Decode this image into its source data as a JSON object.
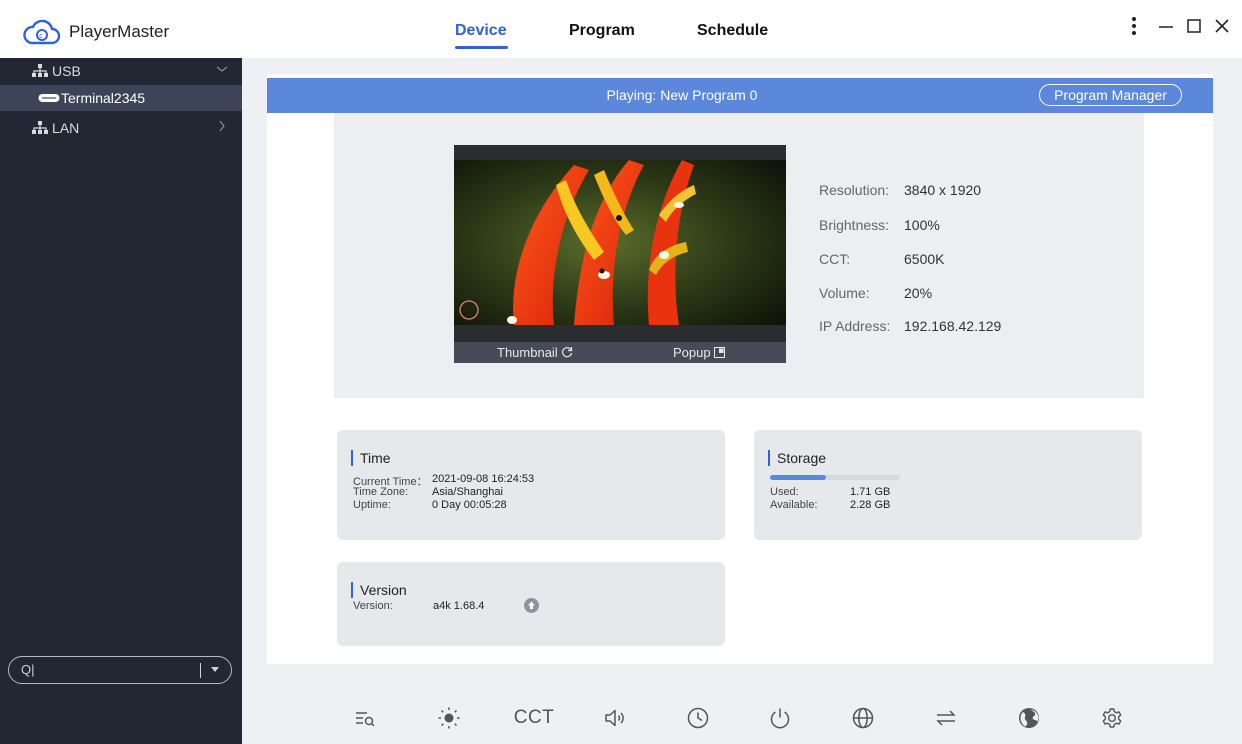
{
  "app": {
    "title": "PlayerMaster"
  },
  "nav": {
    "tabs": [
      {
        "label": "Device",
        "active": true
      },
      {
        "label": "Program"
      },
      {
        "label": "Schedule"
      }
    ]
  },
  "sidebar": {
    "items": [
      {
        "label": "USB",
        "icon": "network-icon",
        "expanded": true
      },
      {
        "label": "Terminal2345",
        "icon": "device-icon",
        "selected": true
      },
      {
        "label": "LAN",
        "icon": "network-icon",
        "expanded": false
      }
    ],
    "search_text": "Q|"
  },
  "playing": {
    "text": "Playing: New Program 0",
    "manager_label": "Program Manager"
  },
  "preview": {
    "thumbnail_label": "Thumbnail",
    "popup_label": "Popup"
  },
  "device_info": [
    {
      "label": "Resolution:",
      "value": "3840 x 1920"
    },
    {
      "label": "Brightness:",
      "value": "100%"
    },
    {
      "label": "CCT:",
      "value": "6500K"
    },
    {
      "label": "Volume:",
      "value": "20%"
    },
    {
      "label": "IP Address:",
      "value": "192.168.42.129"
    }
  ],
  "time_card": {
    "title": "Time",
    "rows": [
      {
        "label": "Current Time：",
        "value": "2021-09-08 16:24:53"
      },
      {
        "label": "Time Zone:",
        "value": "Asia/Shanghai"
      },
      {
        "label": "Uptime:",
        "value": "0 Day 00:05:28"
      }
    ]
  },
  "storage_card": {
    "title": "Storage",
    "used_fraction": 0.43,
    "rows": [
      {
        "label": "Used:",
        "value": "1.71 GB"
      },
      {
        "label": "Available:",
        "value": "2.28 GB"
      }
    ]
  },
  "version_card": {
    "title": "Version",
    "rows": [
      {
        "label": "Version:",
        "value": "a4k 1.68.4"
      }
    ]
  },
  "toolbar": {
    "tools": [
      "list-search-icon",
      "brightness-icon",
      "cct-icon",
      "volume-icon",
      "clock-icon",
      "power-icon",
      "network-globe-icon",
      "transfer-icon",
      "earth-icon",
      "settings-icon"
    ],
    "cct_label": "CCT"
  },
  "colors": {
    "accent": "#2d63d4",
    "bar": "#5c88dc",
    "sidebar": "#232733"
  }
}
